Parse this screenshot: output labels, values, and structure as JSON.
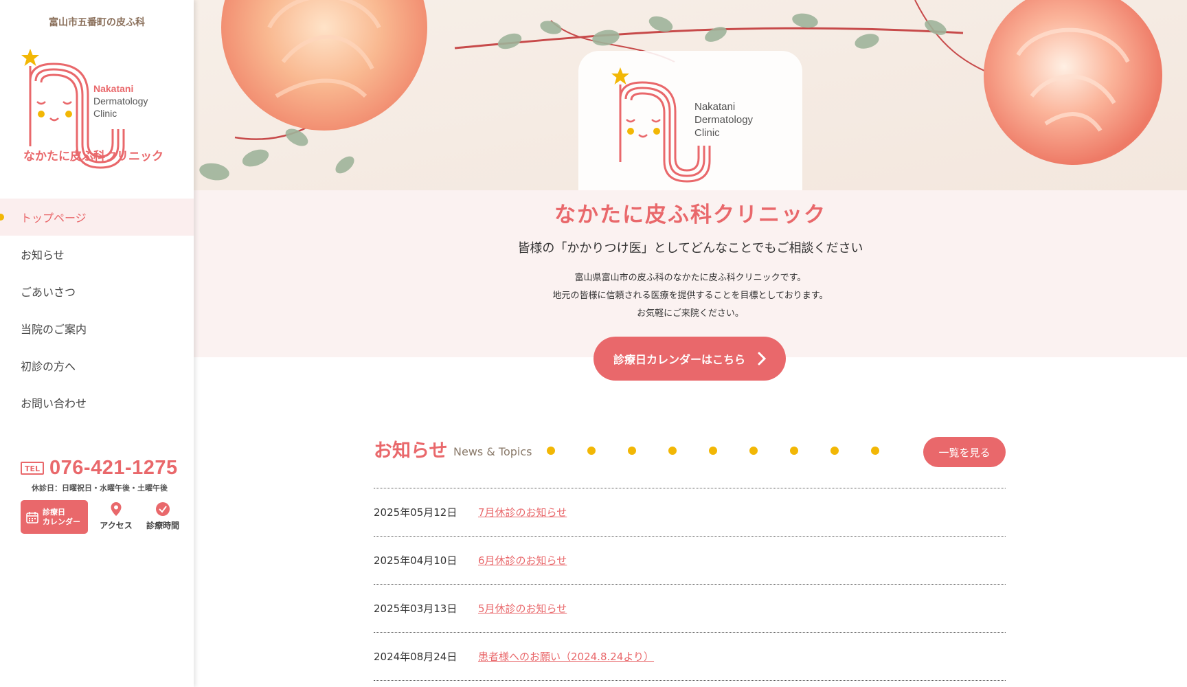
{
  "sidebar": {
    "tagline": "富山市五番町の皮ふ科",
    "logo": {
      "en_line1": "Nakatani",
      "en_line2": "Dermatology",
      "en_line3": "Clinic",
      "ja_name": "なかたに皮ふ科クリニック"
    },
    "nav": [
      {
        "label": "トップページ",
        "active": true
      },
      {
        "label": "お知らせ"
      },
      {
        "label": "ごあいさつ"
      },
      {
        "label": "当院のご案内"
      },
      {
        "label": "初診の方へ"
      },
      {
        "label": "お問い合わせ"
      }
    ],
    "tel_badge": "TEL",
    "tel_number": "076-421-1275",
    "closed_days": "休診日：日曜祝日・水曜午後・土曜午後",
    "calendar_btn": {
      "line1": "診療日",
      "line2": "カレンダー"
    },
    "access_label": "アクセス",
    "hours_label": "診療時間"
  },
  "hero": {
    "logo": {
      "en_line1": "Nakatani",
      "en_line2": "Dermatology",
      "en_line3": "Clinic"
    }
  },
  "intro": {
    "title": "なかたに皮ふ科クリニック",
    "subtitle": "皆様の「かかりつけ医」としてどんなことでもご相談ください",
    "lines": [
      "富山県富山市の皮ふ科のなかたに皮ふ科クリニックです。",
      "地元の皆様に信頼される医療を提供することを目標としております。",
      "お気軽にご来院ください。"
    ],
    "cta_label": "診療日カレンダーはこちら"
  },
  "news": {
    "title": "お知らせ",
    "subtitle": "News & Topics",
    "more_label": "一覧を見る",
    "items": [
      {
        "date": "2025年05月12日",
        "title": "7月休診のお知らせ"
      },
      {
        "date": "2025年04月10日",
        "title": "6月休診のお知らせ"
      },
      {
        "date": "2025年03月13日",
        "title": "5月休診のお知らせ"
      },
      {
        "date": "2024年08月24日",
        "title": "患者様へのお願い（2024.8.24より）"
      }
    ]
  },
  "colors": {
    "accent": "#e9686b",
    "star": "#f2b705",
    "intro_bg": "#fbf2f1"
  }
}
